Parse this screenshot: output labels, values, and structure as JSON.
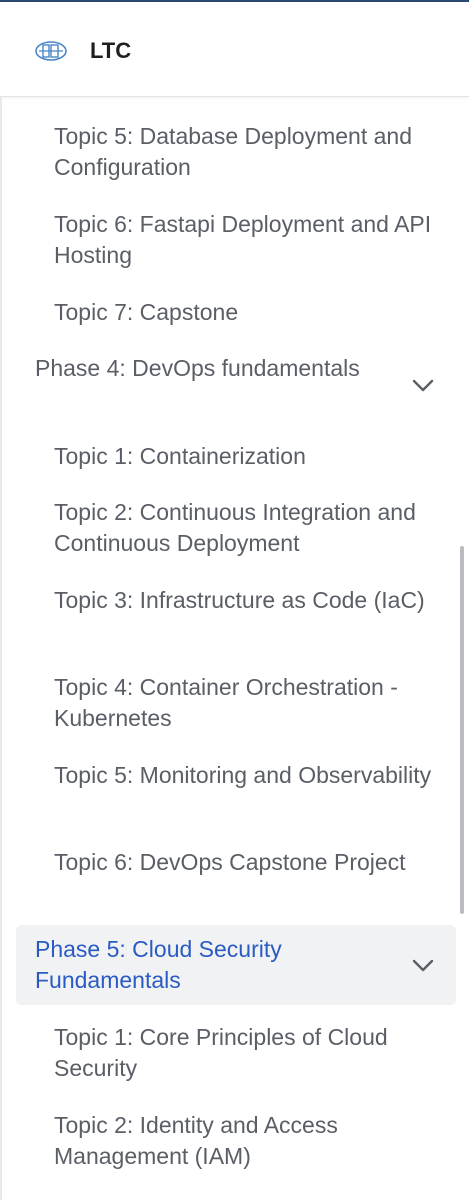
{
  "header": {
    "title": "LTC",
    "logo_icon": "ltc-logo-icon"
  },
  "nav": {
    "topics_phase3_tail": [
      {
        "label": "Topic 5: Database Deployment and Configuration"
      },
      {
        "label": "Topic 6: Fastapi Deployment and API Hosting"
      },
      {
        "label": "Topic 7: Capstone"
      }
    ],
    "phase4": {
      "label": "Phase 4: DevOps fundamentals",
      "icon": "chevron-down-icon",
      "topics": [
        {
          "label": "Topic 1: Containerization"
        },
        {
          "label": "Topic 2: Continuous Integration and Continuous Deployment"
        },
        {
          "label": "Topic 3: Infrastructure as Code (IaC)"
        },
        {
          "label": "Topic 4: Container Orchestration - Kubernetes"
        },
        {
          "label": "Topic 5: Monitoring and Observability"
        },
        {
          "label": "Topic 6: DevOps Capstone Project"
        }
      ]
    },
    "phase5": {
      "label": "Phase 5: Cloud Security Fundamentals",
      "icon": "chevron-down-icon",
      "active": true,
      "topics": [
        {
          "label": "Topic 1: Core Principles of Cloud Security"
        },
        {
          "label": "Topic 2: Identity and Access Management (IAM)"
        }
      ]
    }
  },
  "colors": {
    "text": "#5a5e66",
    "active_text": "#2a5bc3",
    "active_bg": "#f1f2f4",
    "header_text": "#1d1f23",
    "logo_blue": "#4a86c8"
  }
}
